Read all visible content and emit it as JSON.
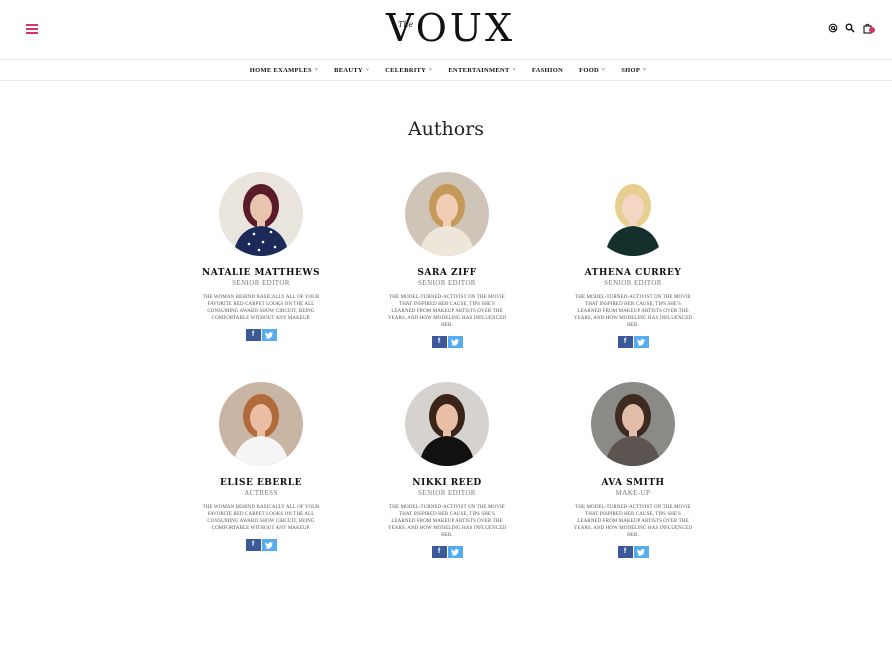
{
  "header": {
    "logo_small": "The",
    "logo_word": "VOUX"
  },
  "nav": {
    "items": [
      {
        "label": "HOME EXAMPLES",
        "dropdown": true
      },
      {
        "label": "BEAUTY",
        "dropdown": true
      },
      {
        "label": "CELEBRITY",
        "dropdown": true
      },
      {
        "label": "ENTERTAINMENT",
        "dropdown": true
      },
      {
        "label": "FASHION",
        "dropdown": false
      },
      {
        "label": "FOOD",
        "dropdown": true
      },
      {
        "label": "SHOP",
        "dropdown": true
      }
    ]
  },
  "page": {
    "title": "Authors"
  },
  "authors": [
    {
      "name": "NATALIE MATTHEWS",
      "role": "SENIOR EDITOR",
      "bio": "THE WOMAN BEHIND BASICALLY ALL OF YOUR FAVORITE RED CARPET LOOKS ON THE ALL CONSUMING AWARD SHOW CIRCUIT, BEING COMFORTABLE WITHOUT ANY MAKEUP."
    },
    {
      "name": "SARA ZIFF",
      "role": "SENIOR EDITOR",
      "bio": "THE MODEL-TURNED-ACTIVIST ON THE MOVIE THAT INSPIRED HER CAUSE, TIPS SHE'S LEARNED FROM MAKEUP ARTISTS OVER THE YEARS, AND HOW MODELING HAS INFLUENCED HER."
    },
    {
      "name": "ATHENA CURREY",
      "role": "SENIOR EDITOR",
      "bio": "THE MODEL-TURNED-ACTIVIST ON THE MOVIE THAT INSPIRED HER CAUSE, TIPS SHE'S LEARNED FROM MAKEUP ARTISTS OVER THE YEARS, AND HOW MODELING HAS INFLUENCED HER."
    },
    {
      "name": "ELISE EBERLE",
      "role": "ACTRESS",
      "bio": "THE WOMAN BEHIND BASICALLY ALL OF YOUR FAVORITE RED CARPET LOOKS ON THE ALL CONSUMING AWARD SHOW CIRCUIT, BEING COMFORTABLE WITHOUT ANY MAKEUP."
    },
    {
      "name": "NIKKI REED",
      "role": "SENIOR EDITOR",
      "bio": "THE MODEL-TURNED-ACTIVIST ON THE MOVIE THAT INSPIRED HER CAUSE, TIPS SHE'S LEARNED FROM MAKEUP ARTISTS OVER THE YEARS, AND HOW MODELING HAS INFLUENCED HER."
    },
    {
      "name": "AVA SMITH",
      "role": "MAKE-UP",
      "bio": "THE MODEL-TURNED-ACTIVIST ON THE MOVIE THAT INSPIRED HER CAUSE, TIPS SHE'S LEARNED FROM MAKEUP ARTISTS OVER THE YEARS, AND HOW MODELING HAS INFLUENCED HER."
    }
  ],
  "social": {
    "facebook_glyph": "f",
    "twitter_glyph": "t"
  },
  "icons": {
    "menu": "hamburger-icon",
    "at": "at-icon",
    "search": "search-icon",
    "cart": "cart-icon",
    "chevron": "chevron-down-icon"
  },
  "colors": {
    "accent": "#d6336c",
    "facebook": "#3b5998",
    "twitter": "#55acee"
  }
}
